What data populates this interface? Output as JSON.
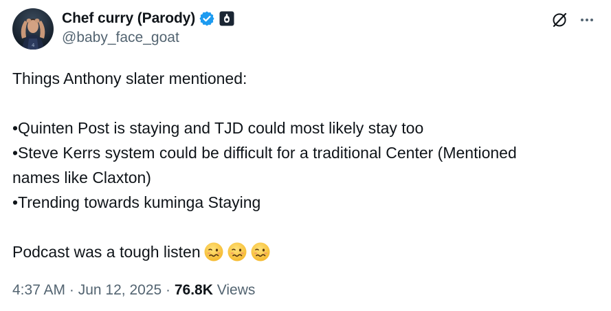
{
  "author": {
    "display_name": "Chef curry (Parody)",
    "handle": "@baby_face_goat",
    "verified_icon": "verified-badge-icon",
    "affiliation_icon": "affiliation-badge-icon"
  },
  "actions": {
    "grok_icon": "grok-icon",
    "more_icon": "more-horizontal-icon"
  },
  "post": {
    "lines": [
      "Things Anthony slater mentioned:",
      "",
      "•Quinten Post is staying and TJD could most likely stay too",
      "•Steve Kerrs system could be difficult for a traditional Center (Mentioned",
      "names like Claxton)",
      "•Trending towards kuminga Staying",
      ""
    ],
    "last_line_text": "Podcast was a tough listen",
    "emoji": [
      "🥴",
      "🥴",
      "🥴"
    ]
  },
  "meta": {
    "time": "4:37 AM",
    "sep1": " · ",
    "date": "Jun 12, 2025",
    "sep2": " · ",
    "views_count": "76.8K",
    "views_label": " Views"
  },
  "colors": {
    "text": "#0f1419",
    "secondary": "#536471",
    "verified_blue": "#1d9bf0"
  }
}
